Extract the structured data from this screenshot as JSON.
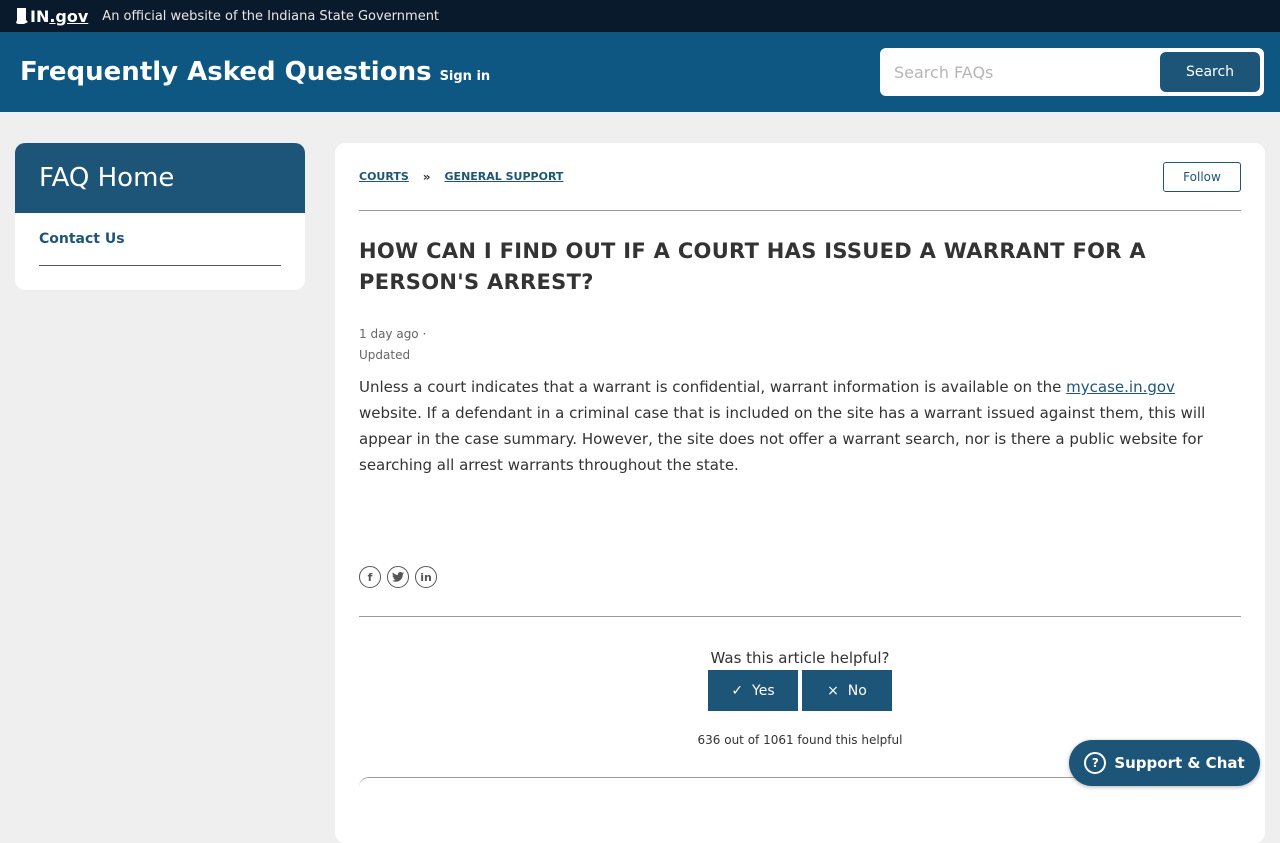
{
  "topbar": {
    "logo_in": "IN",
    "logo_gov": ".gov",
    "official_text": "An official website of the Indiana State Government"
  },
  "header": {
    "title": "Frequently Asked Questions",
    "sign_in": "Sign in",
    "search_placeholder": "Search FAQs",
    "search_button": "Search"
  },
  "sidebar": {
    "title": "FAQ Home",
    "items": [
      {
        "label": "Contact Us"
      }
    ]
  },
  "article": {
    "breadcrumb": [
      {
        "label": "COURTS"
      },
      {
        "label": "GENERAL SUPPORT"
      }
    ],
    "breadcrumb_sep": "»",
    "follow": "Follow",
    "title": "HOW CAN I FIND OUT IF A COURT HAS ISSUED A WARRANT FOR A PERSON'S ARREST?",
    "meta_time": "1 day ago ·",
    "meta_status": "Updated",
    "body_before": "Unless a court indicates that a warrant is confidential, warrant information is available on the ",
    "body_link": "mycase.in.gov",
    "body_after": " website. If a defendant in a criminal case that is included on the site has a warrant issued against them, this will appear in the case summary. However, the site does not offer a warrant search, nor is there a public website for searching all arrest warrants throughout the state.",
    "share_icons": [
      "facebook-icon",
      "twitter-icon",
      "linkedin-icon"
    ]
  },
  "feedback": {
    "question": "Was this article helpful?",
    "yes_icon": "✓",
    "yes": "Yes",
    "no_icon": "×",
    "no": "No",
    "count": "636 out of 1061 found this helpful"
  },
  "support": {
    "label": "Support & Chat",
    "icon": "?"
  },
  "colors": {
    "topbar": "#081a2b",
    "header": "#0e5782",
    "accent": "#1d5579",
    "background": "#efefef"
  }
}
